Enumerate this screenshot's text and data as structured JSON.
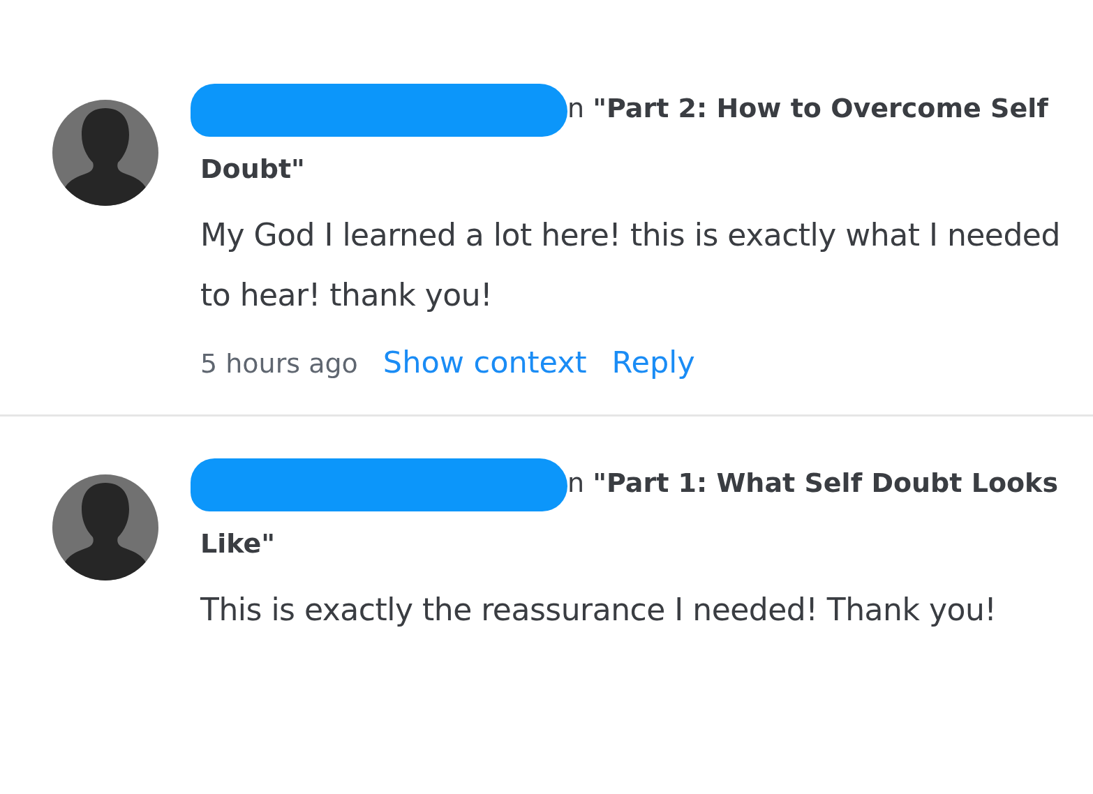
{
  "comments": [
    {
      "prefix": "n",
      "post_title": "\"Part 2: How to Overcome Self Doubt\"",
      "body": "My God I learned a lot here! this is exactly what I needed to hear! thank you!",
      "time": "5 hours ago",
      "actions": [
        "Show context",
        "Reply"
      ]
    },
    {
      "prefix": "n",
      "post_title": "\"Part 1: What Self Doubt Looks Like\"",
      "body": "This is exactly the reassurance I needed! Thank you!"
    }
  ]
}
